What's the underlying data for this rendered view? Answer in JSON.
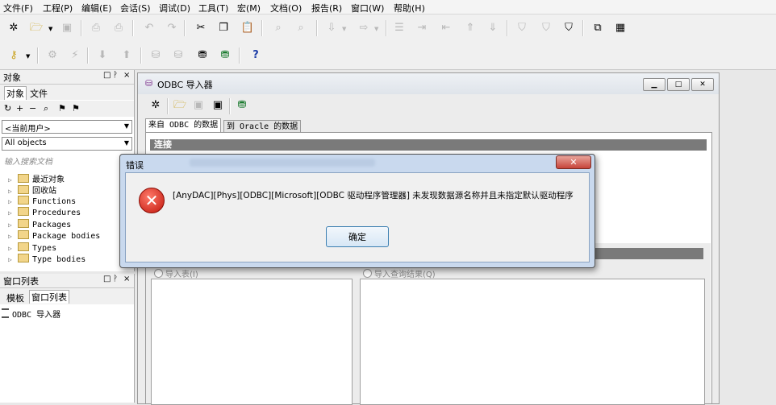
{
  "menu": [
    "文件(F)",
    "工程(P)",
    "编辑(E)",
    "会话(S)",
    "调试(D)",
    "工具(T)",
    "宏(M)",
    "文档(O)",
    "报告(R)",
    "窗口(W)",
    "帮助(H)"
  ],
  "objects_panel": {
    "title": "对象",
    "controls": [
      "□",
      "ᚹ",
      "×"
    ],
    "tabs": [
      "对象",
      "文件"
    ],
    "user_combo": "<当前用户>",
    "objects_combo": "All objects",
    "search_placeholder": "输入搜索文档",
    "tree": [
      "最近对象",
      "回收站",
      "Functions",
      "Procedures",
      "Packages",
      "Package bodies",
      "Types",
      "Type bodies"
    ]
  },
  "window_list_panel": {
    "title": "窗口列表",
    "controls": [
      "□",
      "ᚹ",
      "×"
    ],
    "tabs": [
      "模板",
      "窗口列表"
    ],
    "items": [
      "ODBC 导入器"
    ]
  },
  "odbc_window": {
    "title": "ODBC 导入器",
    "tabs": [
      "来自 ODBC 的数据",
      "到 Oracle 的数据"
    ],
    "section_connect": "连接",
    "radio_import_table": "导入表(I)",
    "radio_import_query": "导入查询结果(Q)"
  },
  "error_dialog": {
    "title": "错误",
    "message": "[AnyDAC][Phys][ODBC][Microsoft][ODBC 驱动程序管理器] 未发现数据源名称并且未指定默认驱动程序",
    "ok_label": "确定",
    "close_glyph": "✕",
    "icon_glyph": "✕"
  },
  "colors": {
    "section_bar": "#7a7a7a",
    "dialog_frame": "#c9d9ee",
    "error_icon": "#c0150b",
    "ok_border": "#3c7fb1"
  },
  "icons": {
    "help_glyph": "?"
  }
}
